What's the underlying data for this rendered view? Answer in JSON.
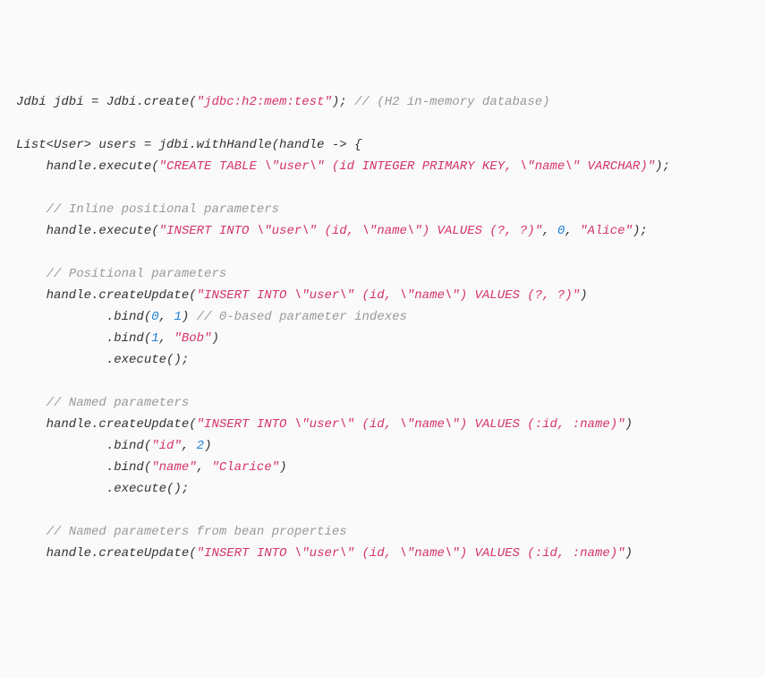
{
  "code": {
    "lines": [
      [
        {
          "t": "Jdbi jdbi = Jdbi.create(",
          "c": "default"
        },
        {
          "t": "\"jdbc:h2:mem:test\"",
          "c": "string"
        },
        {
          "t": "); ",
          "c": "default"
        },
        {
          "t": "// (H2 in-memory database)",
          "c": "comment"
        }
      ],
      [],
      [
        {
          "t": "List<User> users = jdbi.withHandle(handle -> {",
          "c": "default"
        }
      ],
      [
        {
          "t": "    handle.execute(",
          "c": "default"
        },
        {
          "t": "\"CREATE TABLE \\\"user\\\" (id INTEGER PRIMARY KEY, \\\"name\\\" VARCHAR)\"",
          "c": "string"
        },
        {
          "t": ");",
          "c": "default"
        }
      ],
      [],
      [
        {
          "t": "    ",
          "c": "default"
        },
        {
          "t": "// Inline positional parameters",
          "c": "comment"
        }
      ],
      [
        {
          "t": "    handle.execute(",
          "c": "default"
        },
        {
          "t": "\"INSERT INTO \\\"user\\\" (id, \\\"name\\\") VALUES (?, ?)\"",
          "c": "string"
        },
        {
          "t": ", ",
          "c": "default"
        },
        {
          "t": "0",
          "c": "number"
        },
        {
          "t": ", ",
          "c": "default"
        },
        {
          "t": "\"Alice\"",
          "c": "string"
        },
        {
          "t": ");",
          "c": "default"
        }
      ],
      [],
      [
        {
          "t": "    ",
          "c": "default"
        },
        {
          "t": "// Positional parameters",
          "c": "comment"
        }
      ],
      [
        {
          "t": "    handle.createUpdate(",
          "c": "default"
        },
        {
          "t": "\"INSERT INTO \\\"user\\\" (id, \\\"name\\\") VALUES (?, ?)\"",
          "c": "string"
        },
        {
          "t": ")",
          "c": "default"
        }
      ],
      [
        {
          "t": "            .bind(",
          "c": "default"
        },
        {
          "t": "0",
          "c": "number"
        },
        {
          "t": ", ",
          "c": "default"
        },
        {
          "t": "1",
          "c": "number"
        },
        {
          "t": ") ",
          "c": "default"
        },
        {
          "t": "// 0-based parameter indexes",
          "c": "comment"
        }
      ],
      [
        {
          "t": "            .bind(",
          "c": "default"
        },
        {
          "t": "1",
          "c": "number"
        },
        {
          "t": ", ",
          "c": "default"
        },
        {
          "t": "\"Bob\"",
          "c": "string"
        },
        {
          "t": ")",
          "c": "default"
        }
      ],
      [
        {
          "t": "            .execute();",
          "c": "default"
        }
      ],
      [],
      [
        {
          "t": "    ",
          "c": "default"
        },
        {
          "t": "// Named parameters",
          "c": "comment"
        }
      ],
      [
        {
          "t": "    handle.createUpdate(",
          "c": "default"
        },
        {
          "t": "\"INSERT INTO \\\"user\\\" (id, \\\"name\\\") VALUES (:id, :name)\"",
          "c": "string"
        },
        {
          "t": ")",
          "c": "default"
        }
      ],
      [
        {
          "t": "            .bind(",
          "c": "default"
        },
        {
          "t": "\"id\"",
          "c": "string"
        },
        {
          "t": ", ",
          "c": "default"
        },
        {
          "t": "2",
          "c": "number"
        },
        {
          "t": ")",
          "c": "default"
        }
      ],
      [
        {
          "t": "            .bind(",
          "c": "default"
        },
        {
          "t": "\"name\"",
          "c": "string"
        },
        {
          "t": ", ",
          "c": "default"
        },
        {
          "t": "\"Clarice\"",
          "c": "string"
        },
        {
          "t": ")",
          "c": "default"
        }
      ],
      [
        {
          "t": "            .execute();",
          "c": "default"
        }
      ],
      [],
      [
        {
          "t": "    ",
          "c": "default"
        },
        {
          "t": "// Named parameters from bean properties",
          "c": "comment"
        }
      ],
      [
        {
          "t": "    handle.createUpdate(",
          "c": "default"
        },
        {
          "t": "\"INSERT INTO \\\"user\\\" (id, \\\"name\\\") VALUES (:id, :name)\"",
          "c": "string"
        },
        {
          "t": ")",
          "c": "default"
        }
      ]
    ]
  }
}
